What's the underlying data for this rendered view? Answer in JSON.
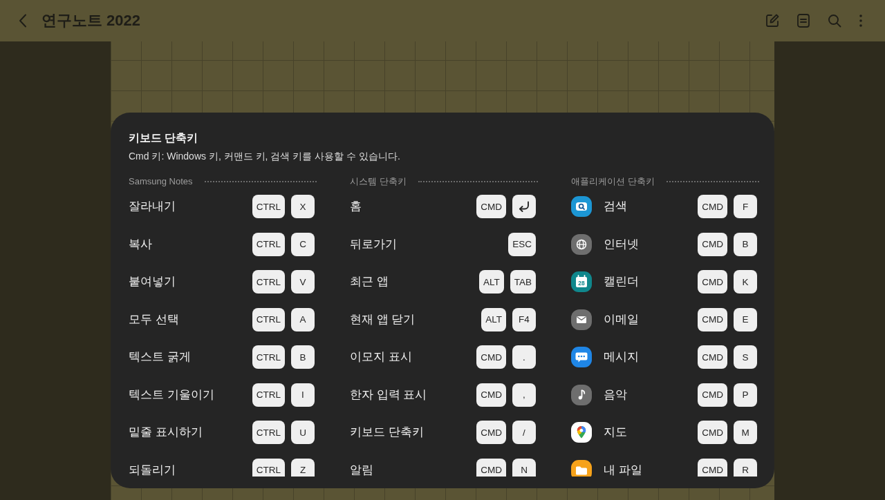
{
  "app_bar": {
    "title": "연구노트 2022"
  },
  "dialog": {
    "title": "키보드 단축키",
    "subtitle": "Cmd 키: Windows 키, 커맨드 키, 검색 키를 사용할 수 있습니다.",
    "sections": [
      {
        "title": "Samsung Notes",
        "items": [
          {
            "label": "잘라내기",
            "keys": [
              {
                "kind": "text",
                "label": "CTRL"
              },
              {
                "kind": "text",
                "label": "X"
              }
            ]
          },
          {
            "label": "복사",
            "keys": [
              {
                "kind": "text",
                "label": "CTRL"
              },
              {
                "kind": "text",
                "label": "C"
              }
            ]
          },
          {
            "label": "붙여넣기",
            "keys": [
              {
                "kind": "text",
                "label": "CTRL"
              },
              {
                "kind": "text",
                "label": "V"
              }
            ]
          },
          {
            "label": "모두 선택",
            "keys": [
              {
                "kind": "text",
                "label": "CTRL"
              },
              {
                "kind": "text",
                "label": "A"
              }
            ]
          },
          {
            "label": "텍스트 굵게",
            "keys": [
              {
                "kind": "text",
                "label": "CTRL"
              },
              {
                "kind": "text",
                "label": "B"
              }
            ]
          },
          {
            "label": "텍스트 기울이기",
            "keys": [
              {
                "kind": "text",
                "label": "CTRL"
              },
              {
                "kind": "text",
                "label": "I"
              }
            ]
          },
          {
            "label": "밑줄 표시하기",
            "keys": [
              {
                "kind": "text",
                "label": "CTRL"
              },
              {
                "kind": "text",
                "label": "U"
              }
            ]
          },
          {
            "label": "되돌리기",
            "keys": [
              {
                "kind": "text",
                "label": "CTRL"
              },
              {
                "kind": "text",
                "label": "Z"
              }
            ]
          }
        ]
      },
      {
        "title": "시스템 단축키",
        "items": [
          {
            "label": "홈",
            "keys": [
              {
                "kind": "text",
                "label": "CMD"
              },
              {
                "kind": "enter"
              }
            ]
          },
          {
            "label": "뒤로가기",
            "keys": [
              {
                "kind": "text",
                "label": "ESC"
              }
            ]
          },
          {
            "label": "최근 앱",
            "keys": [
              {
                "kind": "text",
                "label": "ALT"
              },
              {
                "kind": "text",
                "label": "TAB"
              }
            ]
          },
          {
            "label": "현재 앱 닫기",
            "keys": [
              {
                "kind": "text",
                "label": "ALT"
              },
              {
                "kind": "text",
                "label": "F4"
              }
            ]
          },
          {
            "label": "이모지 표시",
            "keys": [
              {
                "kind": "text",
                "label": "CMD"
              },
              {
                "kind": "text",
                "label": "."
              }
            ]
          },
          {
            "label": "한자 입력 표시",
            "keys": [
              {
                "kind": "text",
                "label": "CMD"
              },
              {
                "kind": "text",
                "label": ","
              }
            ]
          },
          {
            "label": "키보드 단축키",
            "keys": [
              {
                "kind": "text",
                "label": "CMD"
              },
              {
                "kind": "text",
                "label": "/"
              }
            ]
          },
          {
            "label": "알림",
            "keys": [
              {
                "kind": "text",
                "label": "CMD"
              },
              {
                "kind": "text",
                "label": "N"
              }
            ]
          }
        ]
      },
      {
        "title": "애플리케이션 단축키",
        "items": [
          {
            "kind": "search",
            "label": "검색",
            "keys": [
              {
                "kind": "text",
                "label": "CMD"
              },
              {
                "kind": "text",
                "label": "F"
              }
            ]
          },
          {
            "kind": "internet",
            "label": "인터넷",
            "keys": [
              {
                "kind": "text",
                "label": "CMD"
              },
              {
                "kind": "text",
                "label": "B"
              }
            ]
          },
          {
            "kind": "calendar",
            "icon_text": "28",
            "label": "캘린더",
            "keys": [
              {
                "kind": "text",
                "label": "CMD"
              },
              {
                "kind": "text",
                "label": "K"
              }
            ]
          },
          {
            "kind": "email",
            "label": "이메일",
            "keys": [
              {
                "kind": "text",
                "label": "CMD"
              },
              {
                "kind": "text",
                "label": "E"
              }
            ]
          },
          {
            "kind": "messages",
            "label": "메시지",
            "keys": [
              {
                "kind": "text",
                "label": "CMD"
              },
              {
                "kind": "text",
                "label": "S"
              }
            ]
          },
          {
            "kind": "music",
            "label": "음악",
            "keys": [
              {
                "kind": "text",
                "label": "CMD"
              },
              {
                "kind": "text",
                "label": "P"
              }
            ]
          },
          {
            "kind": "maps",
            "label": "지도",
            "keys": [
              {
                "kind": "text",
                "label": "CMD"
              },
              {
                "kind": "text",
                "label": "M"
              }
            ]
          },
          {
            "kind": "files",
            "label": "내 파일",
            "keys": [
              {
                "kind": "text",
                "label": "CMD"
              },
              {
                "kind": "text",
                "label": "R"
              }
            ]
          }
        ]
      }
    ]
  }
}
